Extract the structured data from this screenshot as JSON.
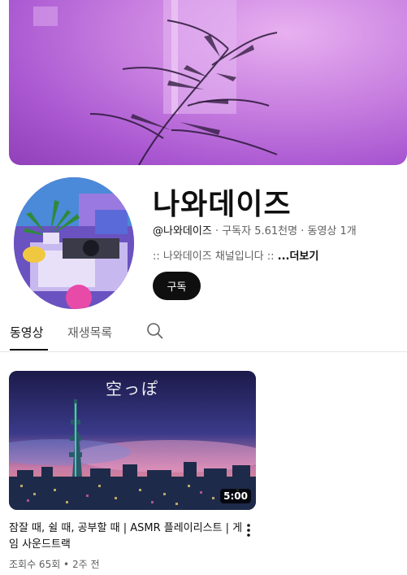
{
  "channel": {
    "name": "나와데이즈",
    "handle": "@나와데이즈",
    "stats": " · 구독자 5.61천명 · 동영상 1개",
    "description": ":: 나와데이즈 채널입니다 :: ",
    "more_label": "...더보기",
    "subscribe_label": "구독"
  },
  "tabs": {
    "videos": "동영상",
    "playlists": "재생목록"
  },
  "video": {
    "thumb_text": "空っぽ",
    "duration": "5:00",
    "title": "잠잘 때, 쉴 때, 공부할 때 | ASMR 플레이리스트 | 게임 사운드트랙",
    "meta": "조회수 65회 • 2주 전"
  },
  "colors": {
    "banner": "#c880e0",
    "subscribe_bg": "#0f0f0f"
  }
}
